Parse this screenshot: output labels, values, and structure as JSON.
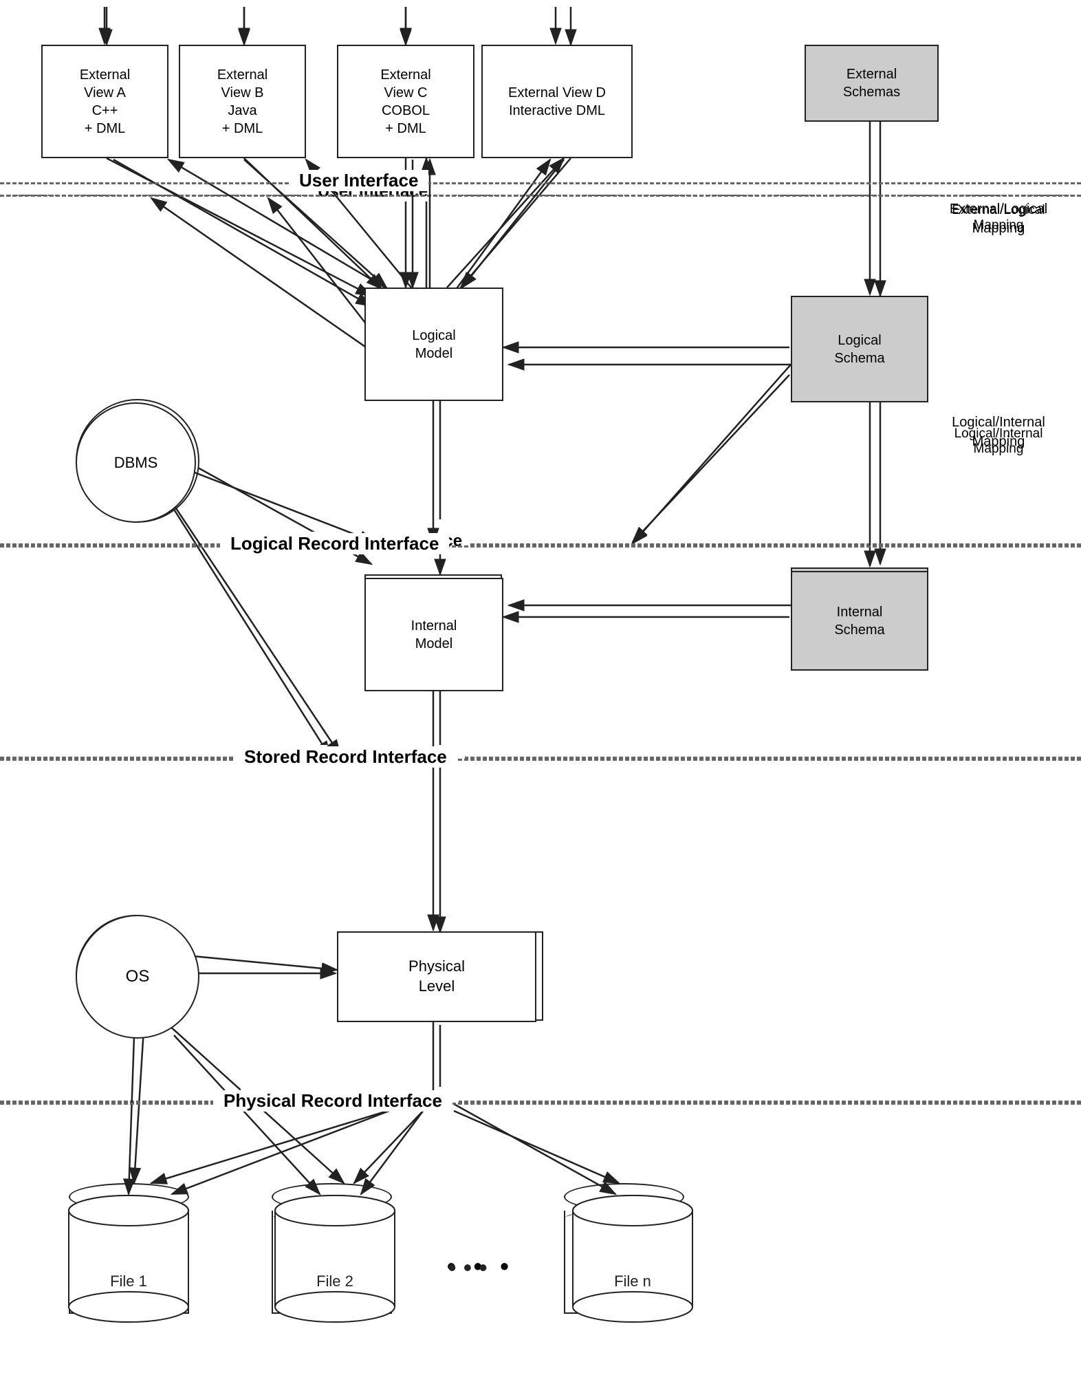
{
  "boxes": {
    "extViewA": {
      "label": "External\nView A\nC++\n+ DML"
    },
    "extViewB": {
      "label": "External\nView B\nJava\n+ DML"
    },
    "extViewC": {
      "label": "External\nView C\nCOBOL\n+ DML"
    },
    "extViewD": {
      "label": "External View D\nInteractive DML"
    },
    "extSchemas": {
      "label": "External\nSchemas"
    },
    "logicalModel": {
      "label": "Logical\nModel"
    },
    "logicalSchema": {
      "label": "Logical\nSchema"
    },
    "internalModel": {
      "label": "Internal\nModel"
    },
    "internalSchema": {
      "label": "Internal\nSchema"
    },
    "physicalLevel": {
      "label": "Physical\nLevel"
    }
  },
  "circles": {
    "dbms": {
      "label": "DBMS"
    },
    "os": {
      "label": "OS"
    }
  },
  "interfaces": {
    "userInterface": {
      "label": "User Interface"
    },
    "logicalRecordInterface": {
      "label": "Logical Record Interface"
    },
    "storedRecordInterface": {
      "label": "Stored Record Interface"
    },
    "physicalRecordInterface": {
      "label": "Physical Record Interface"
    }
  },
  "sideLabels": {
    "externalLogical": {
      "label": "External/Logical\nMapping"
    },
    "logicalInternal": {
      "label": "Logical/Internal\nMapping"
    }
  },
  "files": {
    "file1": {
      "label": "File 1"
    },
    "file2": {
      "label": "File 2"
    },
    "fileN": {
      "label": "File n"
    },
    "dots": {
      "label": "• • •"
    }
  }
}
